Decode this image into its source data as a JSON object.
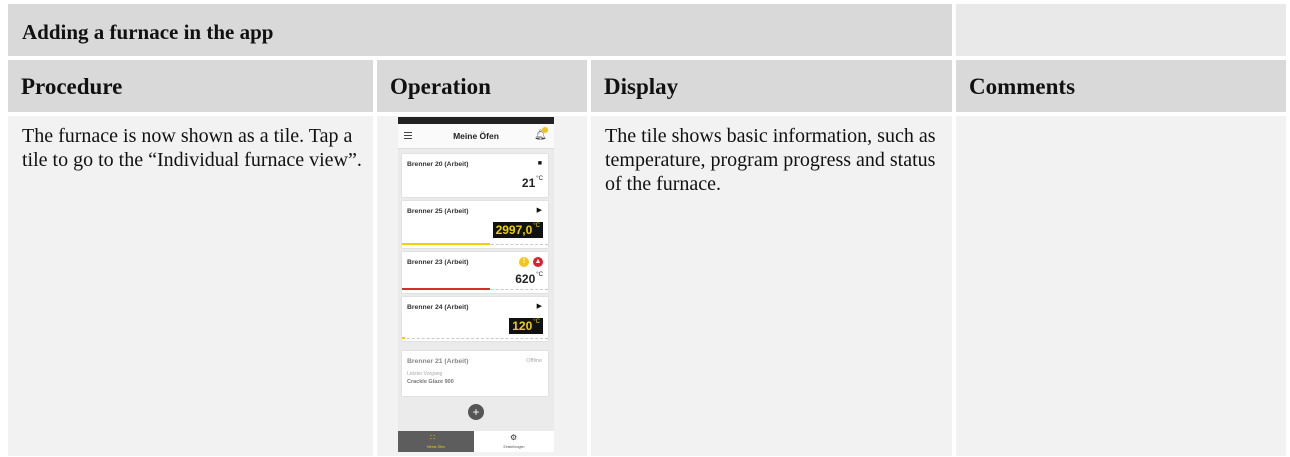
{
  "title": "Adding a furnace in the app",
  "headers": {
    "procedure": "Procedure",
    "operation": "Operation",
    "display": "Display",
    "comments": "Comments"
  },
  "row": {
    "procedure": "The furnace is now shown as a tile. Tap a tile to go to the “Individual furnace view”.",
    "display": "The tile shows basic information, such as temperature, program progress and status of the furnace.",
    "comments": ""
  },
  "phone": {
    "app_title": "Meine Öfen",
    "tiles": [
      {
        "name": "Brenner 20 (Arbeit)",
        "status_icon": "stop-icon",
        "temp": "21",
        "unit": "°C",
        "progress": 0
      },
      {
        "name": "Brenner 25 (Arbeit)",
        "status_icon": "play-icon",
        "temp": "2997,0",
        "unit": "°C",
        "progress": 0.6
      },
      {
        "name": "Brenner 23 (Arbeit)",
        "status_icon": "warning-icon",
        "temp": "620",
        "unit": "°C",
        "progress": 0.6
      },
      {
        "name": "Brenner 24 (Arbeit)",
        "status_icon": "play-icon",
        "temp": "120",
        "unit": "°C",
        "progress": 0.02
      },
      {
        "name": "Brenner 21 (Arbeit)",
        "status": "Offline",
        "last_label": "Letzter Vorgang",
        "program": "Crackle Glaze 900"
      }
    ],
    "nav": {
      "ovens_label": "Meine Öfen",
      "settings_label": "Einstellungen"
    },
    "colors": {
      "accent": "#f0d000",
      "progress_yellow": "#f0d000",
      "progress_red": "#d32f2f",
      "alarm_red": "#e01f2d",
      "warning_yellow": "#f5c518"
    }
  }
}
